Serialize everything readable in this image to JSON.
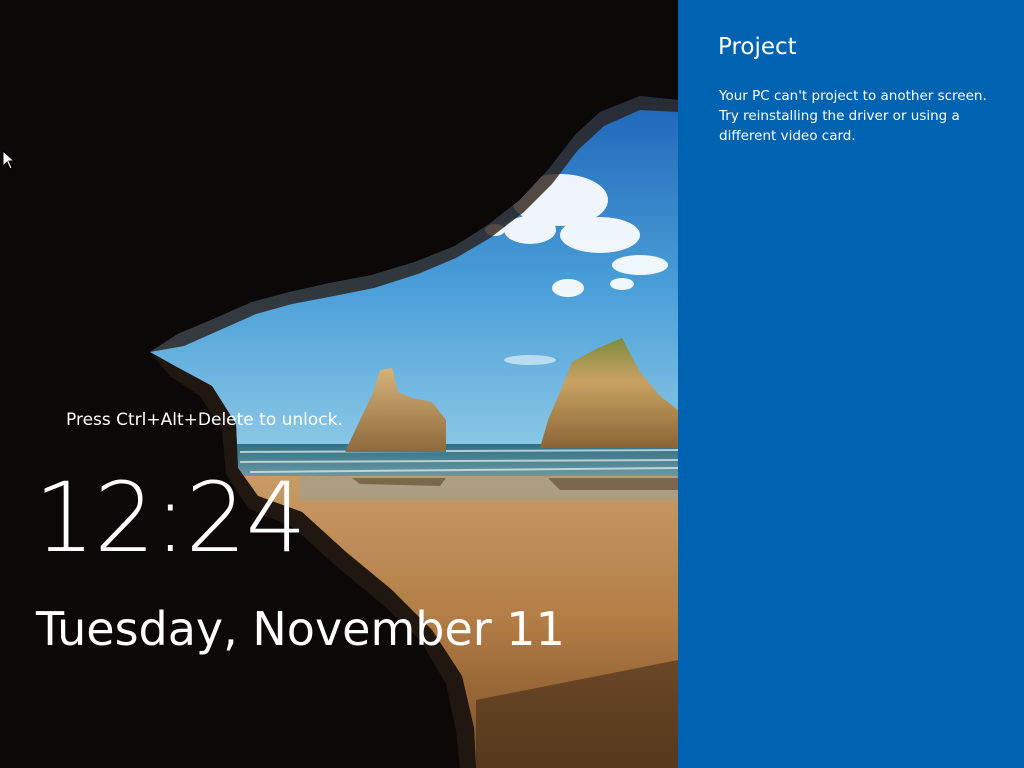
{
  "lock_screen": {
    "unlock_hint": "Press Ctrl+Alt+Delete to unlock.",
    "time": "12:24",
    "date": "Tuesday, November 11",
    "background": "sea-cave-beach-wallpaper"
  },
  "project_pane": {
    "title": "Project",
    "message": "Your PC can't project to another screen. Try reinstalling the driver or using a different video card.",
    "accent_color": "#0063b1"
  },
  "icons": {
    "cursor": "mouse-pointer-icon"
  }
}
